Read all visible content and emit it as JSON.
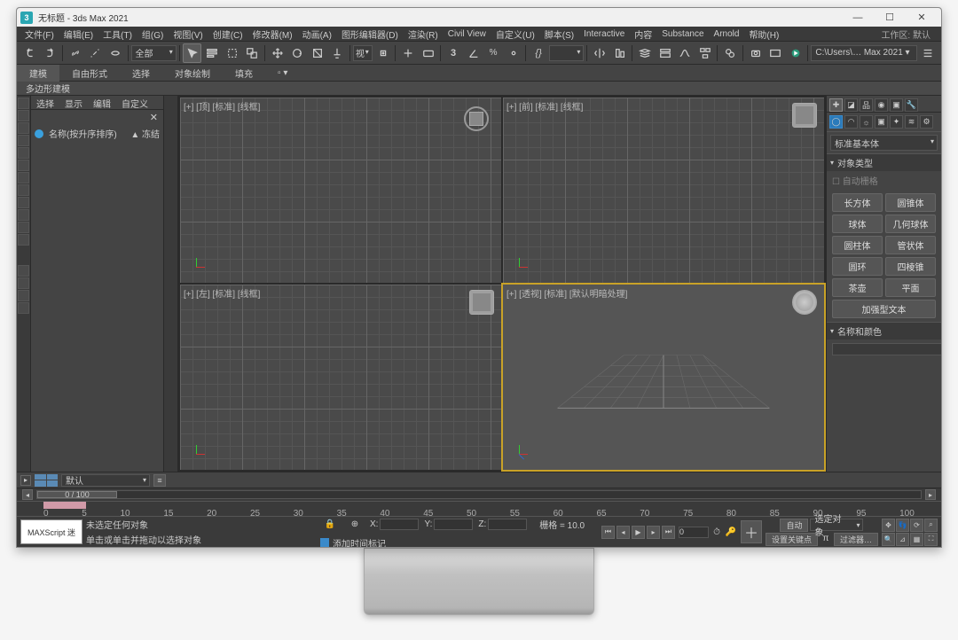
{
  "title": "无标题 - 3ds Max 2021",
  "menu": [
    "文件(F)",
    "编辑(E)",
    "工具(T)",
    "组(G)",
    "视图(V)",
    "创建(C)",
    "修改器(M)",
    "动画(A)",
    "图形编辑器(D)",
    "渲染(R)",
    "Civil View",
    "自定义(U)",
    "脚本(S)",
    "Interactive",
    "内容",
    "Substance",
    "Arnold",
    "帮助(H)"
  ],
  "workspace_label": "工作区: 默认",
  "toolbar_dd": "全部",
  "path": "C:\\Users\\… Max 2021 ▾",
  "ribbon": [
    "建模",
    "自由形式",
    "选择",
    "对象绘制",
    "填充"
  ],
  "ribbon2": "多边形建模",
  "scene_tabs": [
    "选择",
    "显示",
    "编辑",
    "自定义"
  ],
  "scene_header": "名称(按升序排序)",
  "scene_header_r": "▲ 冻结",
  "layer_default": "默认",
  "viewports": {
    "tl": "[+] [顶] [标准] [线框]",
    "tr": "[+] [前] [标准] [线框]",
    "bl": "[+] [左] [标准] [线框]",
    "br": "[+] [透视] [标准] [默认明暗处理]"
  },
  "right": {
    "dd": "标准基本体",
    "roll1": "对象类型",
    "autogrid": "自动栅格",
    "buttons": [
      "长方体",
      "圆锥体",
      "球体",
      "几何球体",
      "圆柱体",
      "管状体",
      "圆环",
      "四棱锥",
      "茶壶",
      "平面",
      "加强型文本"
    ],
    "roll2": "名称和颜色"
  },
  "time": "0 / 100",
  "ruler_ticks": [
    "0",
    "5",
    "10",
    "15",
    "20",
    "25",
    "30",
    "35",
    "40",
    "45",
    "50",
    "55",
    "60",
    "65",
    "70",
    "75",
    "80",
    "85",
    "90",
    "95",
    "100"
  ],
  "status": {
    "msi": "MAXScript 迷",
    "l1": "未选定任何对象",
    "l2": "单击或单击并拖动以选择对象",
    "grid": "栅格 = 10.0",
    "addtag": "添加时间标记",
    "auto": "自动",
    "selobj": "选定对象",
    "setkey": "设置关键点",
    "filter": "过滤器…"
  }
}
